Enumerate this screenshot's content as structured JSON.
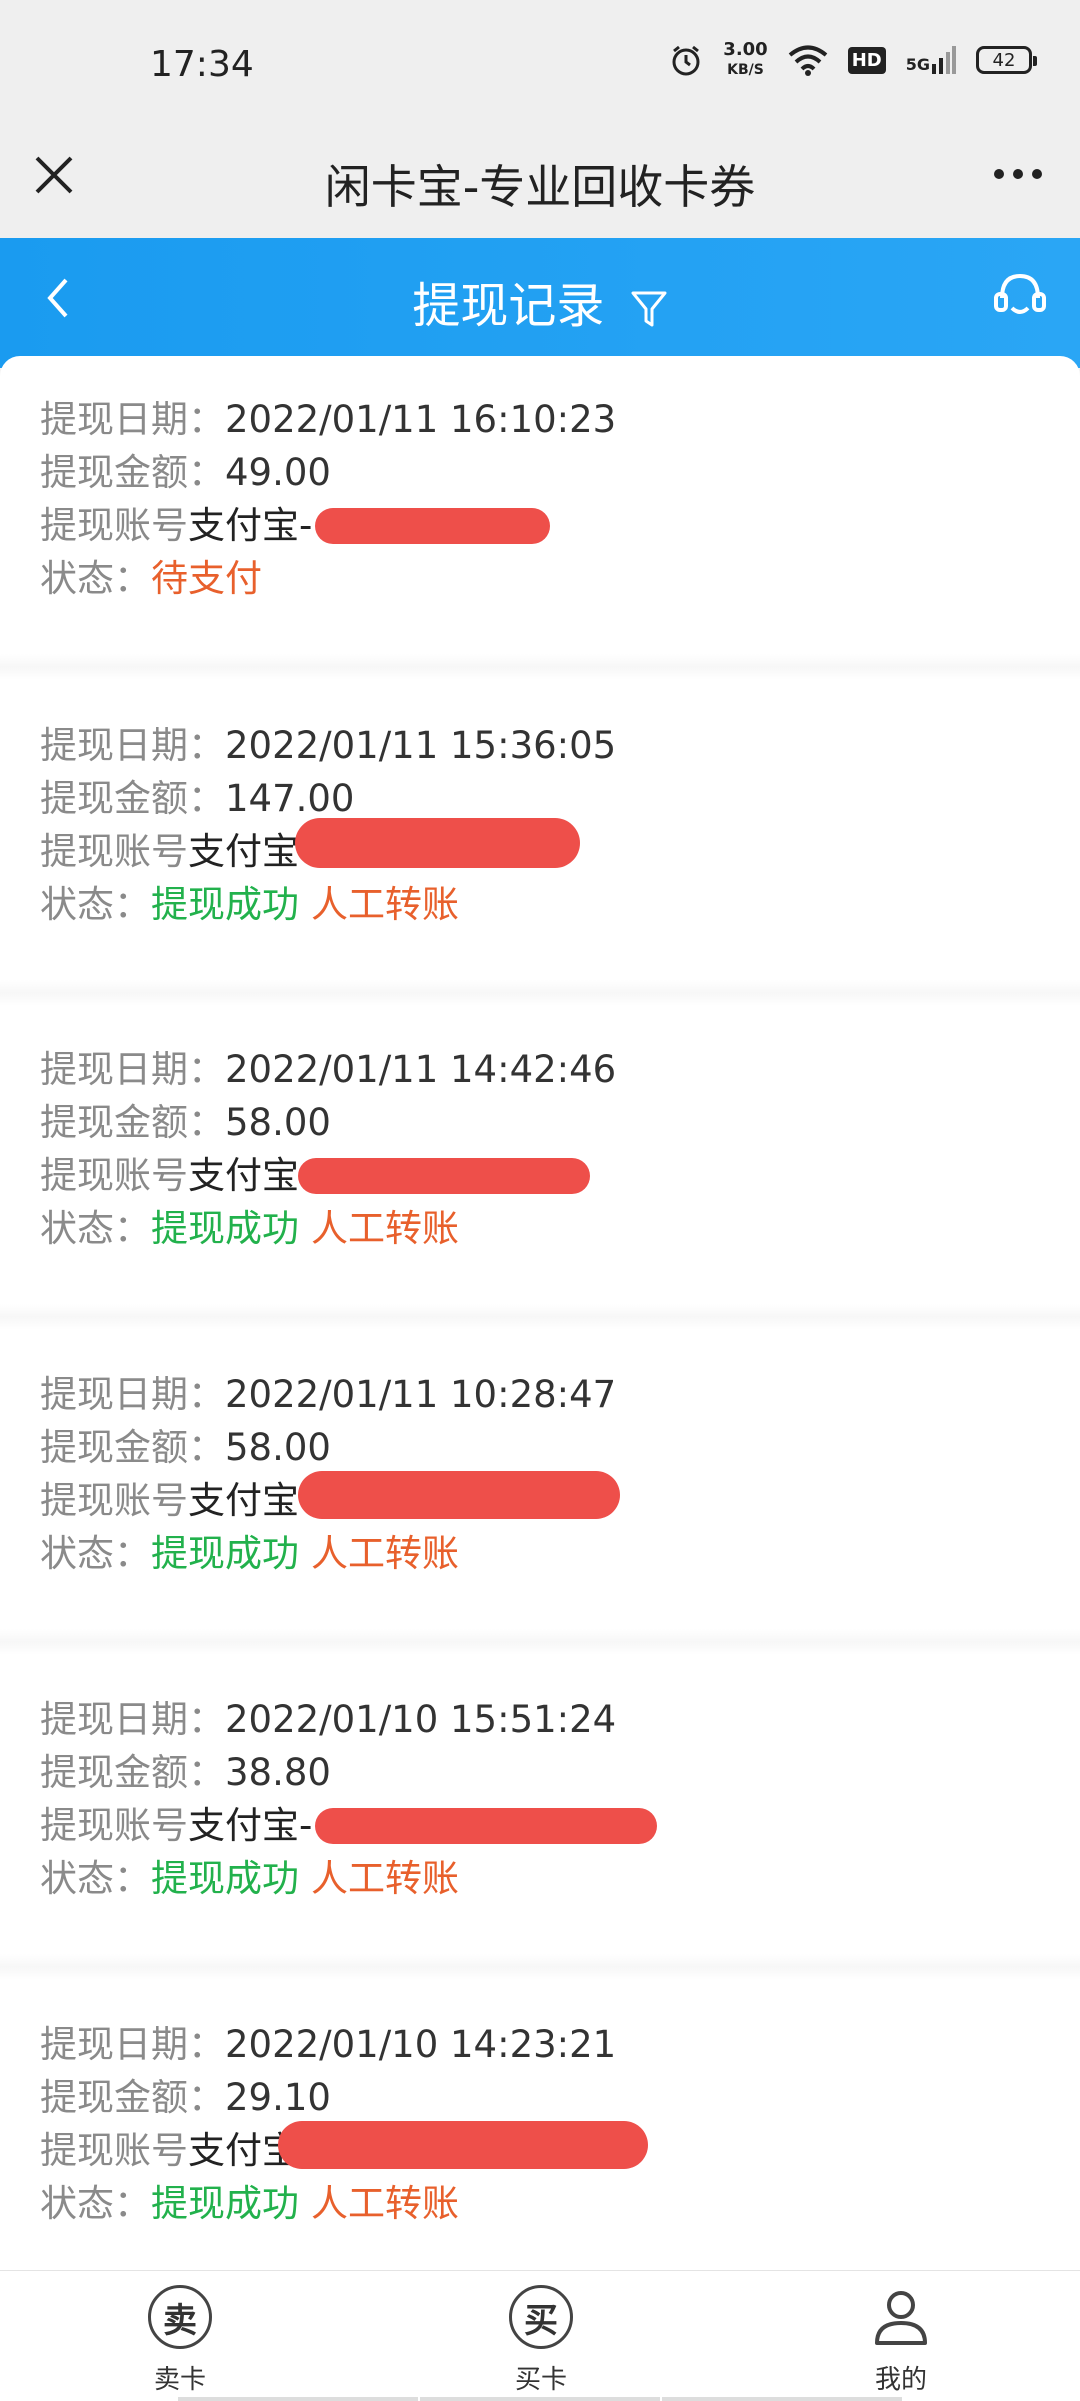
{
  "status_bar": {
    "time": "17:34",
    "net_speed": "3.00",
    "net_unit": "KB/S",
    "hd": "HD",
    "network": "5G",
    "battery": "42"
  },
  "app_header": {
    "title": "闲卡宝-专业回收卡券"
  },
  "page_header": {
    "title": "提现记录"
  },
  "labels": {
    "date": "提现日期：",
    "amount": "提现金额：",
    "account": "提现账号",
    "status": "状态："
  },
  "records": [
    {
      "date": "2022/01/11 16:10:23",
      "amount": "49.00",
      "account": "支付宝-",
      "status": "待支付",
      "extra": ""
    },
    {
      "date": "2022/01/11 15:36:05",
      "amount": "147.00",
      "account": "支付宝",
      "status": "提现成功",
      "extra": "人工转账"
    },
    {
      "date": "2022/01/11 14:42:46",
      "amount": "58.00",
      "account": "支付宝",
      "status": "提现成功",
      "extra": "人工转账"
    },
    {
      "date": "2022/01/11 10:28:47",
      "amount": "58.00",
      "account": "支付宝",
      "status": "提现成功",
      "extra": "人工转账"
    },
    {
      "date": "2022/01/10 15:51:24",
      "amount": "38.80",
      "account": "支付宝-",
      "status": "提现成功",
      "extra": "人工转账"
    },
    {
      "date": "2022/01/10 14:23:21",
      "amount": "29.10",
      "account": "支付宝",
      "status": "提现成功",
      "extra": "人工转账"
    }
  ],
  "bottom_nav": {
    "sell_icon": "卖",
    "sell_label": "卖卡",
    "buy_icon": "买",
    "buy_label": "买卡",
    "mine_label": "我的"
  },
  "colors": {
    "header_blue": "#1a9bf0",
    "pending": "#e8602c",
    "success": "#22b14c",
    "redaction": "#ee4f4a"
  }
}
